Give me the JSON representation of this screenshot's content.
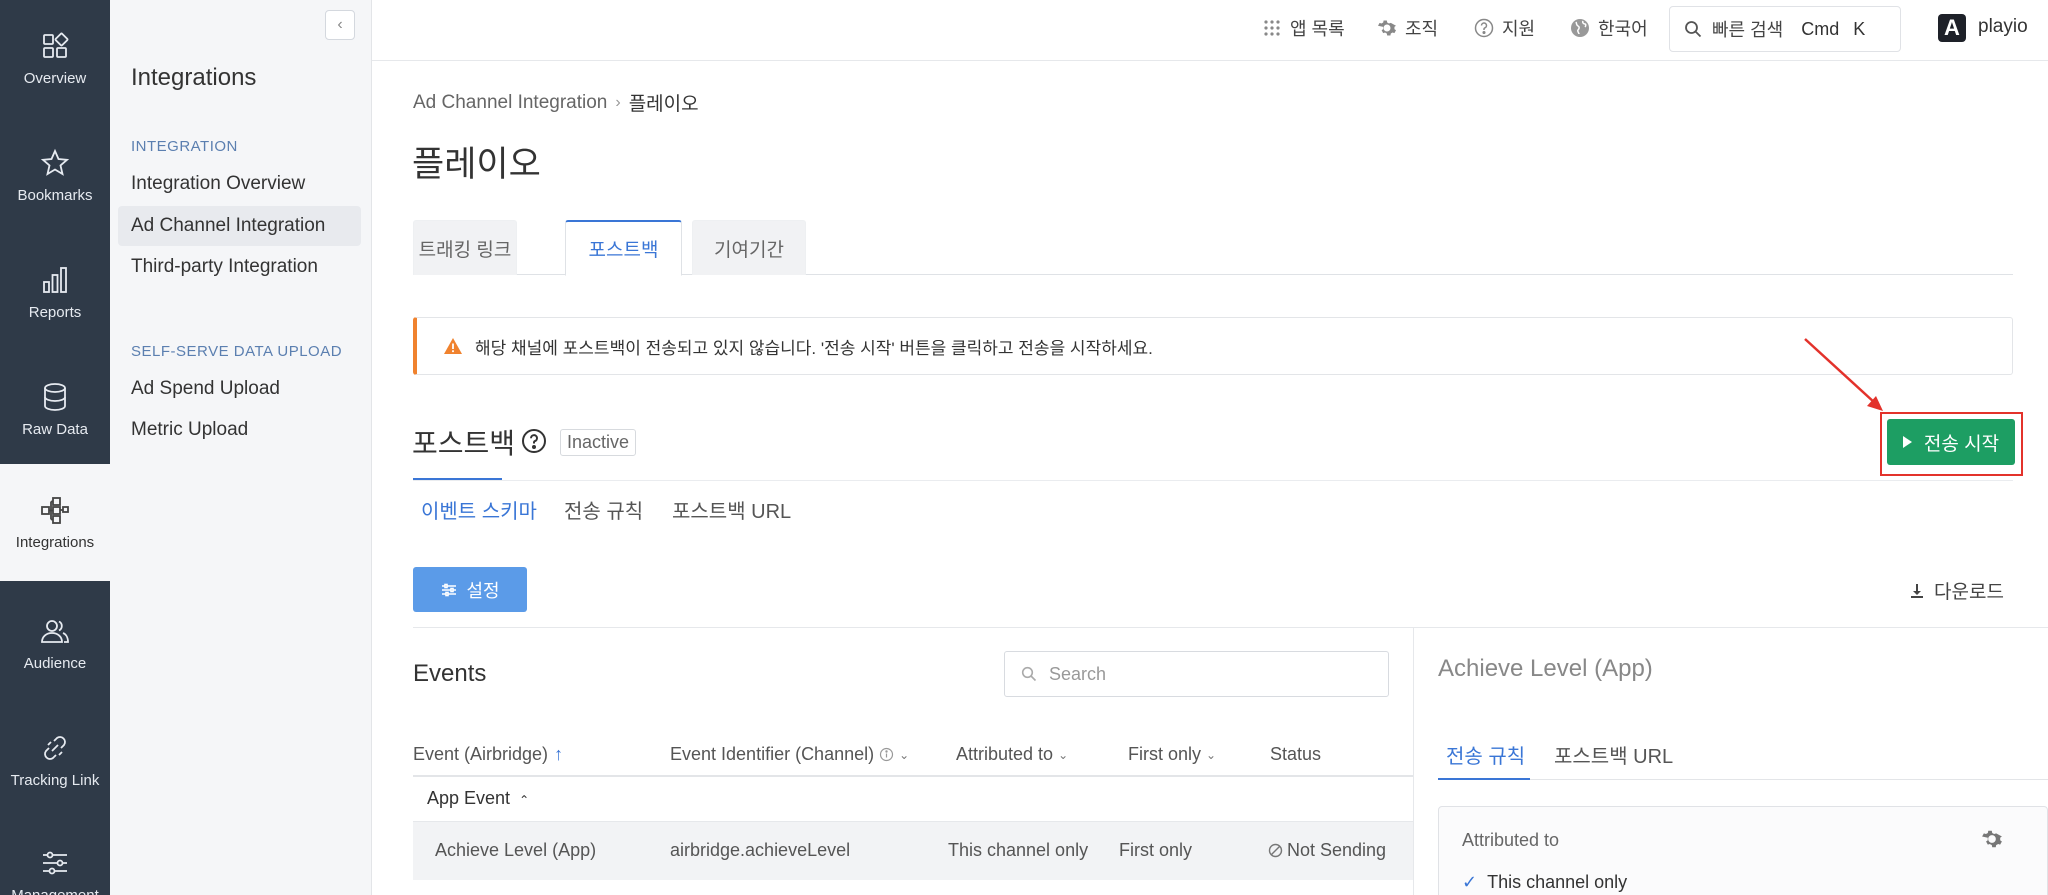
{
  "rail": {
    "items": [
      {
        "label": "Overview",
        "icon": "overview-icon"
      },
      {
        "label": "Bookmarks",
        "icon": "star-icon"
      },
      {
        "label": "Reports",
        "icon": "bar-chart-icon"
      },
      {
        "label": "Raw Data",
        "icon": "database-icon"
      },
      {
        "label": "Integrations",
        "icon": "integrations-icon"
      },
      {
        "label": "Audience",
        "icon": "users-icon"
      },
      {
        "label": "Tracking Link",
        "icon": "link-icon"
      },
      {
        "label": "Management",
        "icon": "sliders-icon"
      }
    ]
  },
  "sidebar": {
    "title": "Integrations",
    "section1": "INTEGRATION",
    "links1": [
      "Integration Overview",
      "Ad Channel Integration",
      "Third-party Integration"
    ],
    "section2": "SELF-SERVE DATA UPLOAD",
    "links2": [
      "Ad Spend Upload",
      "Metric Upload"
    ],
    "collapse": "‹"
  },
  "topbar": {
    "apps": "앱 목록",
    "org": "조직",
    "support": "지원",
    "language": "한국어",
    "search": "빠른 검색",
    "kbd_cmd": "Cmd",
    "kbd_k": "K",
    "brand_logo": "A",
    "brand": "playio"
  },
  "breadcrumb": {
    "parent": "Ad Channel Integration",
    "separator": "›",
    "current": "플레이오"
  },
  "page_title": "플레이오",
  "tabs": [
    "트래킹 링크",
    "포스트백",
    "기여기간"
  ],
  "alert": "해당 채널에 포스트백이 전송되고 있지 않습니다. '전송 시작' 버튼을 클릭하고 전송을 시작하세요.",
  "postback": {
    "title": "포스트백",
    "status": "Inactive",
    "start_button": "전송 시작",
    "subtabs": [
      "이벤트 스키마",
      "전송 규칙",
      "포스트백 URL"
    ],
    "settings_button": "설정",
    "download": "다운로드"
  },
  "events": {
    "title": "Events",
    "search_placeholder": "Search",
    "headers": {
      "event": "Event (Airbridge)",
      "sort_indicator": "↑",
      "identifier": "Event Identifier (Channel)",
      "attributed": "Attributed to",
      "first_only": "First only",
      "status": "Status"
    },
    "group": "App Event",
    "rows": [
      {
        "event": "Achieve Level (App)",
        "identifier": "airbridge.achieveLevel",
        "attributed": "This channel only",
        "first_only": "First only",
        "status": "Not Sending"
      }
    ]
  },
  "panel": {
    "title": "Achieve Level (App)",
    "tabs": [
      "전송 규칙",
      "포스트백 URL"
    ],
    "card_label": "Attributed to",
    "card_value": "This channel only"
  },
  "colors": {
    "rail_bg": "#2f3a48",
    "accent": "#3a76d6",
    "start_green": "#1d9e63",
    "alert_orange": "#f0822e",
    "highlight_red": "#e3322b"
  }
}
